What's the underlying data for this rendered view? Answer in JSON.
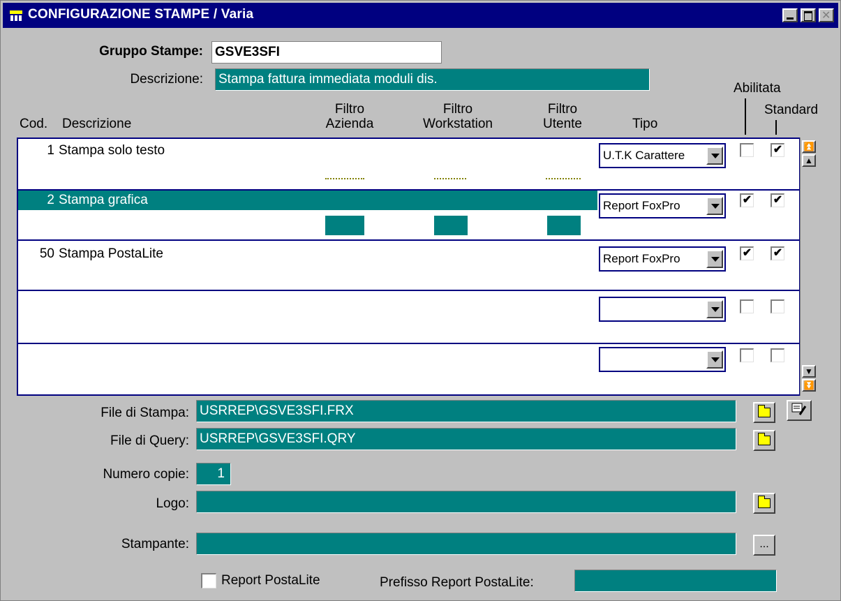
{
  "window": {
    "title": "CONFIGURAZIONE STAMPE / Varia"
  },
  "header": {
    "gruppo_label": "Gruppo Stampe:",
    "gruppo_value": "GSVE3SFI",
    "descrizione_label": "Descrizione:",
    "descrizione_value": "Stampa fattura immediata moduli dis."
  },
  "columns": {
    "cod": "Cod.",
    "descrizione": "Descrizione",
    "filtro_azienda": [
      "Filtro",
      "Azienda"
    ],
    "filtro_workstation": [
      "Filtro",
      "Workstation"
    ],
    "filtro_utente": [
      "Filtro",
      "Utente"
    ],
    "tipo": "Tipo",
    "abilitata": "Abilitata",
    "standard": "Standard"
  },
  "rows": [
    {
      "cod": "1",
      "descrizione": "Stampa solo testo",
      "tipo": "U.T.K Carattere",
      "abilitata": false,
      "standard": true,
      "selected": false
    },
    {
      "cod": "2",
      "descrizione": "Stampa grafica",
      "tipo": "Report FoxPro",
      "abilitata": true,
      "standard": true,
      "selected": true
    },
    {
      "cod": "50",
      "descrizione": "Stampa PostaLite",
      "tipo": "Report FoxPro",
      "abilitata": true,
      "standard": true,
      "selected": false
    },
    {
      "cod": "",
      "descrizione": "",
      "tipo": "",
      "abilitata": false,
      "standard": false,
      "selected": false
    },
    {
      "cod": "",
      "descrizione": "",
      "tipo": "",
      "abilitata": false,
      "standard": false,
      "selected": false
    }
  ],
  "form": {
    "file_stampa_label": "File di Stampa:",
    "file_stampa_value": "USRREP\\GSVE3SFI.FRX",
    "file_query_label": "File di Query:",
    "file_query_value": "USRREP\\GSVE3SFI.QRY",
    "numero_copie_label": "Numero copie:",
    "numero_copie_value": "1",
    "logo_label": "Logo:",
    "logo_value": "",
    "stampante_label": "Stampante:",
    "stampante_value": "",
    "stampante_button": "...",
    "report_postalite_label": "Report PostaLite",
    "prefisso_label": "Prefisso Report PostaLite:",
    "prefisso_value": ""
  },
  "icons": {
    "checkmark": "✔",
    "browse": "folder-icon",
    "edit": "edit-report-icon"
  },
  "colors": {
    "title_bar": "#000080",
    "field_bg": "#008080",
    "window_bg": "#c0c0c0"
  }
}
